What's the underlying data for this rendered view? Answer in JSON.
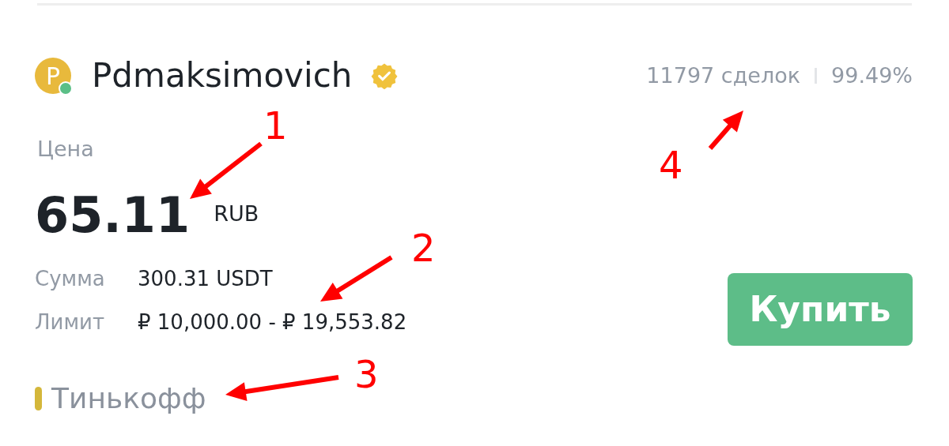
{
  "merchant": {
    "initial": "P",
    "name": "Pdmaksimovich",
    "online": true,
    "verified": true,
    "trades": "11797 сделок",
    "completion": "99.49%"
  },
  "price": {
    "label": "Цена",
    "value": "65.11",
    "currency": "RUB"
  },
  "details": [
    {
      "label": "Сумма",
      "value": "300.31 USDT"
    },
    {
      "label": "Лимит",
      "value": "₽ 10,000.00 - ₽ 19,553.82"
    }
  ],
  "payment_methods": [
    {
      "name": "Тинькофф",
      "color": "#d4b73a"
    }
  ],
  "buy_button": "Купить",
  "annotations": [
    {
      "label": "1"
    },
    {
      "label": "2"
    },
    {
      "label": "3"
    },
    {
      "label": "4"
    }
  ]
}
